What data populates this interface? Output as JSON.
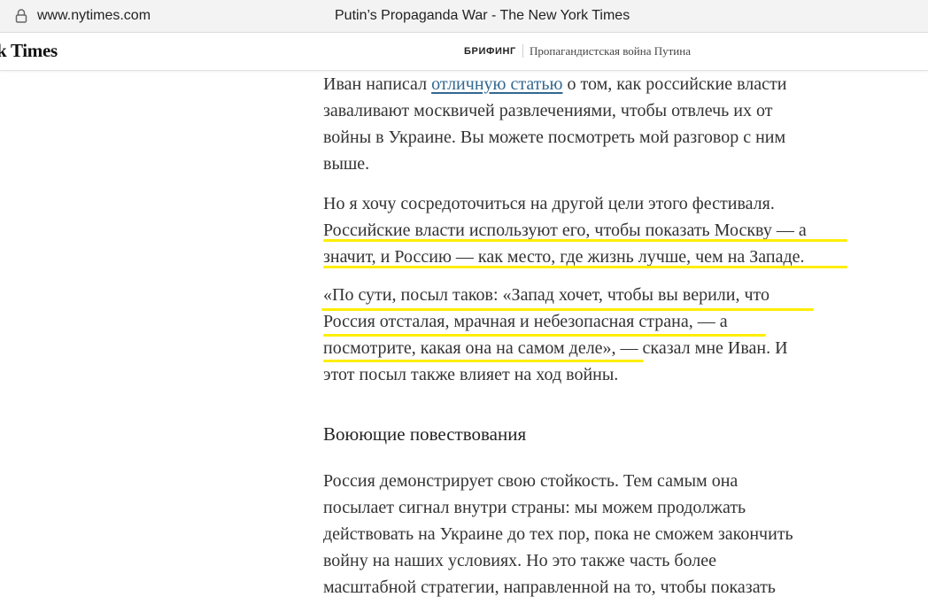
{
  "browser": {
    "url": "www.nytimes.com",
    "tab_title": "Putin’s Propaganda War - The New York Times",
    "lock_icon": "lock-icon"
  },
  "header": {
    "logo": "k Times",
    "section": "БРИФИНГ",
    "subtitle": "Пропагандистская война Путина"
  },
  "article": {
    "p1": {
      "l1_before": "Иван написал ",
      "l1_link": "отличную статью",
      "l1_after": " о том, как российские власти",
      "l2": "заваливают москвичей развлечениями, чтобы отвлечь их от",
      "l3": "войны в Украине. Вы можете посмотреть мой разговор с ним",
      "l4": "выше."
    },
    "p2": {
      "l1": "Но я хочу сосредоточиться на другой цели этого фестиваля.",
      "l2": "Российские власти используют его, чтобы показать Москву — а",
      "l3": "значит, и Россию — как место, где жизнь лучше, чем на Западе."
    },
    "p3": {
      "l1": "«По сути, посыл таков: «Запад хочет, чтобы вы верили, что",
      "l2": "Россия отсталая, мрачная и небезопасная страна, — а",
      "l3": "посмотрите, какая она на самом деле», — сказал мне Иван. И",
      "l4": "этот посыл также влияет на ход войны."
    },
    "subheading": "Воюющие повествования",
    "p4": {
      "l1": "Россия демонстрирует свою стойкость. Тем самым она",
      "l2": "посылает сигнал внутри страны: мы можем продолжать",
      "l3": "действовать на Украине до тех пор, пока не сможем закончить",
      "l4": "войну на наших условиях. Но это также часть более",
      "l5": "масштабной стратегии, направленной на то, чтобы показать"
    }
  },
  "colors": {
    "link": "#326891",
    "highlight": "#ffee00",
    "text": "#333333"
  }
}
